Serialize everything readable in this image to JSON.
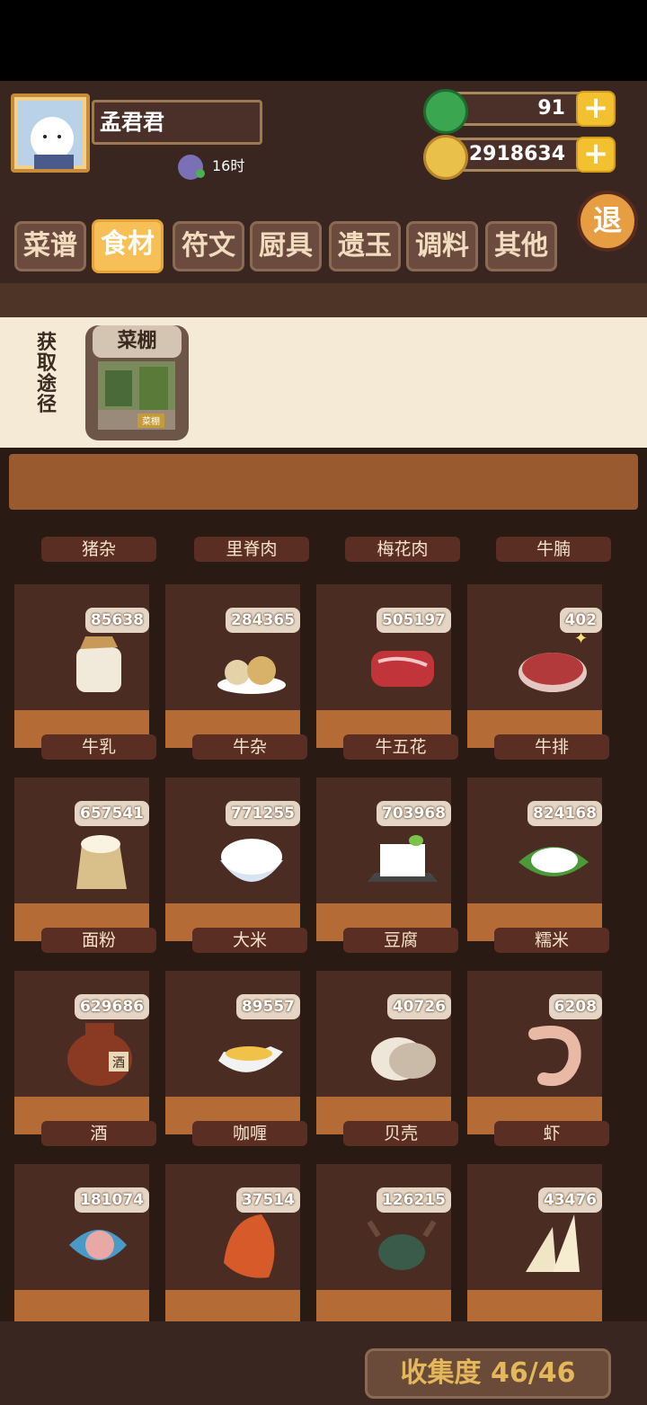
{
  "player": {
    "name": "孟君君",
    "timer": "16时"
  },
  "resources": {
    "jade": "91",
    "coins": "2918634"
  },
  "exit_label": "退",
  "tabs": [
    {
      "label": "菜谱"
    },
    {
      "label": "食材"
    },
    {
      "label": "符文"
    },
    {
      "label": "厨具"
    },
    {
      "label": "遗玉"
    },
    {
      "label": "调料"
    },
    {
      "label": "其他"
    }
  ],
  "active_tab": "食材",
  "source": {
    "label": "获取途径",
    "card_title": "菜棚",
    "card_tag": "菜棚"
  },
  "top_row_labels": [
    "猪杂",
    "里脊肉",
    "梅花肉",
    "牛腩"
  ],
  "items": [
    {
      "name": "牛乳",
      "count": "85638",
      "icon": "milk-jar-icon"
    },
    {
      "name": "牛杂",
      "count": "284365",
      "icon": "offal-plate-icon"
    },
    {
      "name": "牛五花",
      "count": "505197",
      "icon": "beef-belly-icon"
    },
    {
      "name": "牛排",
      "count": "402",
      "icon": "steak-icon"
    },
    {
      "name": "面粉",
      "count": "657541",
      "icon": "flour-sack-icon"
    },
    {
      "name": "大米",
      "count": "771255",
      "icon": "rice-bowl-icon"
    },
    {
      "name": "豆腐",
      "count": "703968",
      "icon": "tofu-icon"
    },
    {
      "name": "糯米",
      "count": "824168",
      "icon": "glutinous-rice-icon"
    },
    {
      "name": "酒",
      "count": "629686",
      "icon": "wine-jar-icon"
    },
    {
      "name": "咖喱",
      "count": "89557",
      "icon": "curry-boat-icon"
    },
    {
      "name": "贝壳",
      "count": "40726",
      "icon": "clam-icon"
    },
    {
      "name": "虾",
      "count": "6208",
      "icon": "shrimp-icon"
    },
    {
      "name": "",
      "count": "181074",
      "icon": "fish-icon"
    },
    {
      "name": "",
      "count": "37514",
      "icon": "red-fish-icon"
    },
    {
      "name": "",
      "count": "126215",
      "icon": "crab-icon"
    },
    {
      "name": "",
      "count": "43476",
      "icon": "shark-fin-icon"
    }
  ],
  "collection": "收集度 46/46"
}
